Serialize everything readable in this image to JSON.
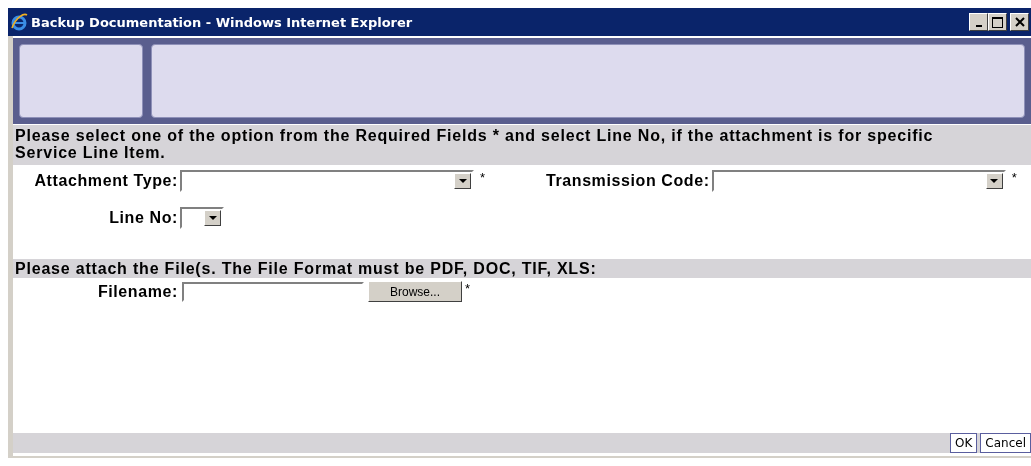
{
  "window": {
    "title": "Backup Documentation - Windows Internet Explorer"
  },
  "instruction": "Please select one of the option from the Required Fields * and select Line No, if the attachment is for specific Service Line Item.",
  "fields": [
    {
      "label": "Attachment Type:",
      "kind": "select",
      "required": "*"
    },
    {
      "label": "Transmission Code:",
      "kind": "select",
      "required": "*"
    },
    {
      "label": "Line No:",
      "kind": "small-select"
    }
  ],
  "attach_note": "Please attach the File(s. The File Format must be PDF, DOC, TIF, XLS:",
  "file_field": {
    "label": "Filename:",
    "button": "Browse...",
    "required": "*"
  },
  "buttons": [
    "OK",
    "Cancel"
  ]
}
